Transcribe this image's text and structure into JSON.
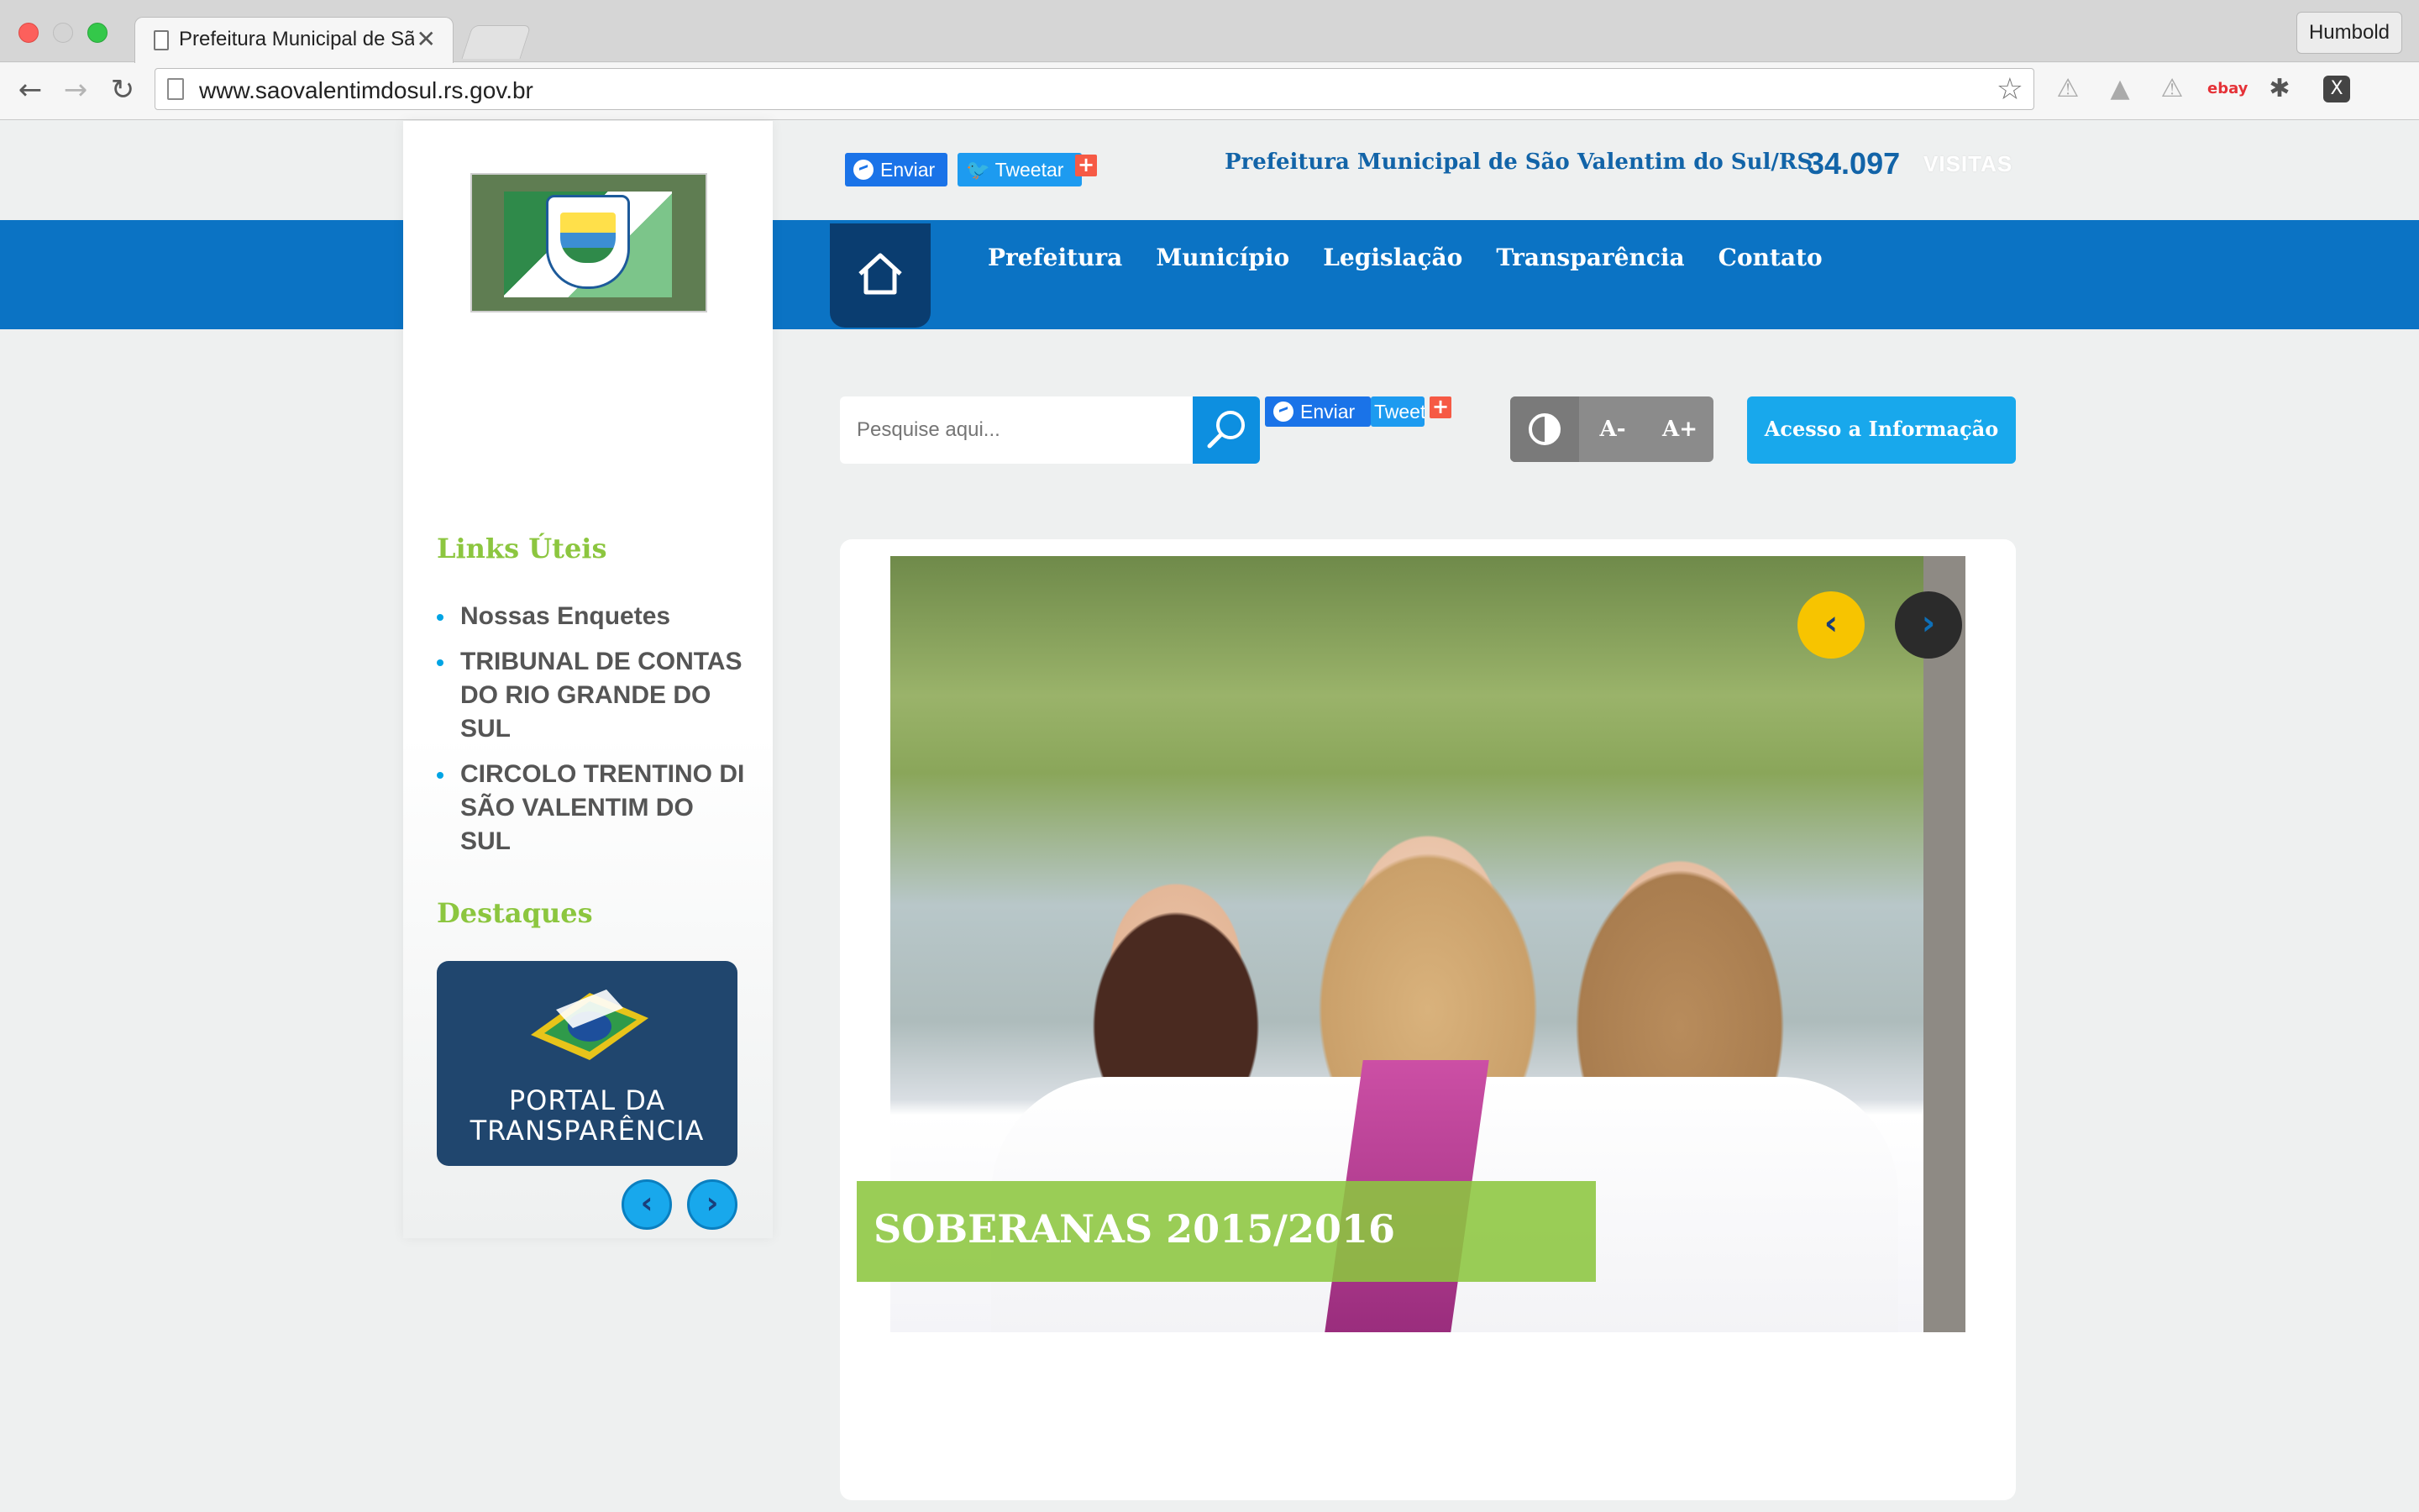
{
  "browser": {
    "tab_title": "Prefeitura Municipal de São Valentim do Sul/RS",
    "tab_close": "✕",
    "profile_name": "Humbold",
    "url": "www.saovalentimdosul.rs.gov.br",
    "ext_ebay": "ebay",
    "ext_x": "X"
  },
  "header": {
    "share_send": "Enviar",
    "share_tweet": "Tweetar",
    "plus": "+",
    "site_title": "Prefeitura Municipal de São Valentim do Sul/RS",
    "visits_count": "34.097",
    "visits_label": "VISITAS"
  },
  "menu": {
    "items": [
      "Prefeitura",
      "Município",
      "Legislação",
      "Transparência",
      "Contato"
    ]
  },
  "search": {
    "placeholder": "Pesquise aqui...",
    "share_send": "Enviar",
    "share_tweet": "Tweet"
  },
  "accessibility": {
    "decrease": "A-",
    "increase": "A+",
    "info_button": "Acesso a Informação"
  },
  "sidebar": {
    "links_title": "Links Úteis",
    "links": [
      "Nossas Enquetes",
      "TRIBUNAL DE CONTAS DO RIO GRANDE DO SUL",
      "CIRCOLO TRENTINO DI SÃO VALENTIM DO SUL"
    ],
    "highlights_title": "Destaques",
    "portal_line1": "PORTAL DA",
    "portal_line2": "TRANSPARÊNCIA",
    "prev": "‹",
    "next": "›"
  },
  "slider": {
    "caption": "SOBERANAS 2015/2016",
    "prev": "‹",
    "next": "›"
  }
}
